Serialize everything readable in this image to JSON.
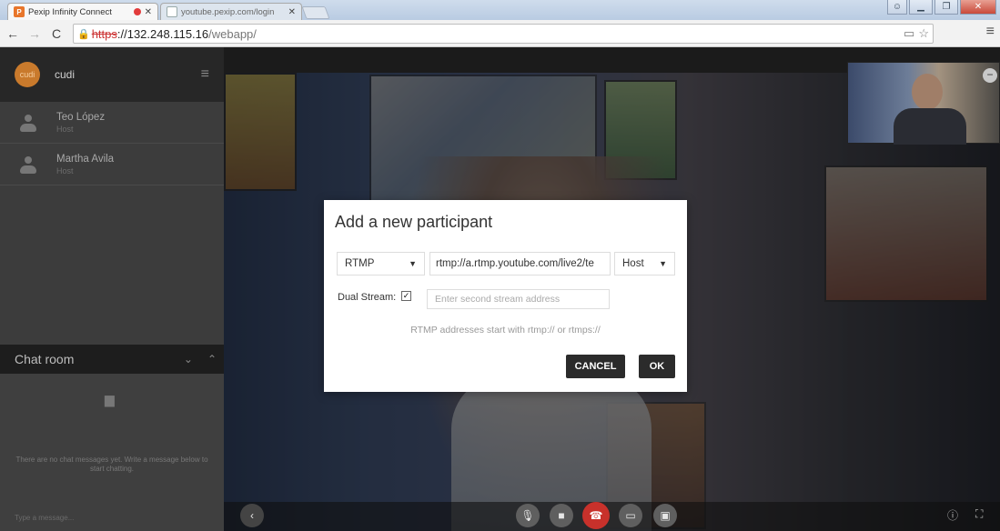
{
  "browser": {
    "tabs": [
      {
        "title": "Pexip Infinity Connect",
        "favicon": "P",
        "recording": true,
        "active": true
      },
      {
        "title": "youtube.pexip.com/login",
        "active": false
      }
    ],
    "url": {
      "scheme": "https",
      "rest": "://132.248.115.16",
      "path": "/webapp/"
    }
  },
  "sidebar": {
    "me": {
      "avatar_text": "cudi",
      "name": "cudi"
    },
    "participants": [
      {
        "name": "Teo López",
        "role": "Host"
      },
      {
        "name": "Martha Avila",
        "role": "Host"
      }
    ],
    "chat": {
      "title": "Chat room",
      "empty_text": "There are no chat messages yet. Write a message below to start chatting.",
      "input_placeholder": "Type a message..."
    }
  },
  "dialog": {
    "title": "Add a new participant",
    "protocol": "RTMP",
    "address": "rtmp://a.rtmp.youtube.com/live2/te",
    "role": "Host",
    "dual_stream_label": "Dual Stream:",
    "dual_stream_checked": true,
    "second_stream_placeholder": "Enter second stream address",
    "hint": "RTMP addresses start with rtmp:// or rtmps://",
    "cancel_label": "CANCEL",
    "ok_label": "OK"
  },
  "colors": {
    "accent": "#e8762b",
    "hangup": "#c8312b",
    "dialog_button": "#2b2b2b"
  }
}
